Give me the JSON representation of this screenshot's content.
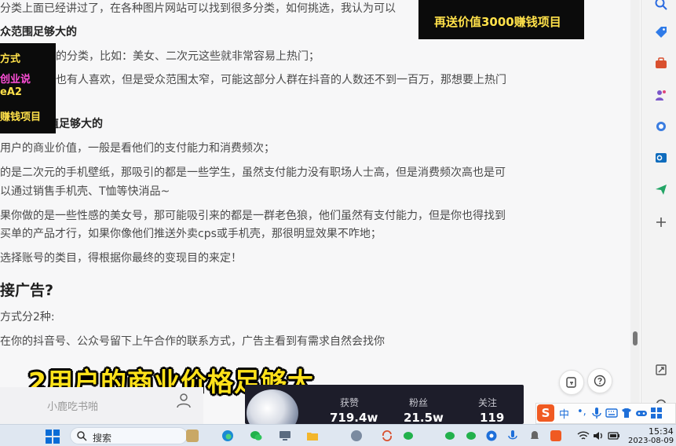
{
  "article": {
    "lines": [
      {
        "text": "分类上面已经讲过了，在各种图片网站可以找到很多分类，如何挑选，我认为可以",
        "style": "normal"
      },
      {
        "text": "众范围足够大的",
        "style": "bold"
      },
      {
        "text": "的分类，比如：美女、二次元这些就非常容易上热门；",
        "style": "normal"
      },
      {
        "text": "也有人喜欢，但是受众范围太窄，可能这部分人群在抖音的人数还不到一百万，那想要上热门",
        "style": "normal"
      },
      {
        "text": "值足够大的",
        "style": "bold"
      },
      {
        "text": "用户的商业价值，一般是看他们的支付能力和消费频次；",
        "style": "normal"
      },
      {
        "text": "的是二次元的手机壁纸，那吸引的都是一些学生，虽然支付能力没有职场人士高，但是消费频次高也是可",
        "style": "normal"
      },
      {
        "text": "以通过销售手机壳、T恤等快消品~",
        "style": "normal"
      },
      {
        "text": "果你做的是一些性感的美女号，那可能吸引来的都是一群老色狼，他们虽然有支付能力，但是你也得找到",
        "style": "normal"
      },
      {
        "text": "买单的产品才行，如果你像他们推送外卖cps或手机壳，那很明显效果不咋地；",
        "style": "normal"
      },
      {
        "text": "选择账号的类目，得根据你最终的变现目的来定！",
        "style": "normal"
      },
      {
        "text": "接广告?",
        "style": "h2"
      },
      {
        "text": "方式分2种:",
        "style": "normal"
      },
      {
        "text": "在你的抖音号、公众号留下上午合作的联系方式，广告主看到有需求自然会找你",
        "style": "normal"
      }
    ]
  },
  "promo_top": {
    "text": "再送价值3000赚钱项目",
    "color": "#ffe14a"
  },
  "promo_left": {
    "lines": [
      {
        "text": "方式",
        "color": "#ffe14a"
      },
      {
        "text": "创业说",
        "color": "#ff4fd8"
      },
      {
        "text": "eA2",
        "color": "#ffe14a"
      },
      {
        "text": "赚钱项目",
        "color": "#ffe14a"
      }
    ]
  },
  "subtitle": "2用户的商业价格足够大",
  "profile": {
    "name": "小鹿吃书啪",
    "stats": [
      {
        "label": "获赞",
        "value": "719.4w"
      },
      {
        "label": "粉丝",
        "value": "21.5w"
      },
      {
        "label": "关注",
        "value": "119"
      }
    ]
  },
  "ime": {
    "logo": "S",
    "mode": "中",
    "punct": "•,",
    "colors": {
      "brand": "#f05a22",
      "icon": "#1e6fd9"
    }
  },
  "taskbar": {
    "search_label": "搜索",
    "time": "15:34",
    "date": "2023-08-09"
  },
  "colors": {
    "accent": "#0a6cd6",
    "subtitle": "#ffe21a"
  }
}
